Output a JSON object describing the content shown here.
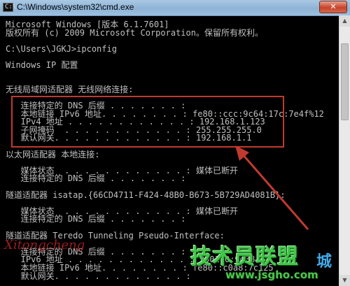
{
  "window": {
    "title": "C:\\Windows\\system32\\cmd.exe",
    "app_icon_glyph": "C:\\",
    "close_glyph": "✕"
  },
  "console_lines": [
    "Microsoft Windows [版本 6.1.7601]",
    "版权所有 (c) 2009 Microsoft Corporation。保留所有权利。",
    "",
    "C:\\Users\\JGKJ>ipconfig",
    "",
    "Windows IP 配置",
    "",
    "",
    "无线局域网适配器 无线网络连接:",
    "",
    "   连接特定的 DNS 后缀 . . . . . . . :",
    "   本地链接 IPv6 地址. . . . . . . . : fe80::ccc:9c64:17c:7e4f%12",
    "   IPv4 地址 . . . . . . . . . . . . : 192.168.1.123",
    "   子网掩码  . . . . . . . . . . . . : 255.255.255.0",
    "   默认网关. . . . . . . . . . . . . : 192.168.1.1",
    "",
    "以太网适配器 本地连接:",
    "",
    "   媒体状态  . . . . . . . . . . . . : 媒体已断开",
    "   连接特定的 DNS 后缀 . . . . . . . :",
    "",
    "隧道适配器 isatap.{66CD4711-F424-48B0-B673-5B729AD4081B}:",
    "",
    "   媒体状态  . . . . . . . . . . . . : 媒体已断开",
    "   连接特定的 DNS 后缀 . . . . . . . :",
    "",
    "隧道适配器 Teredo Tunneling Pseudo-Interface:",
    "",
    "   连接特定的 DNS 后缀 . . . . . . . :",
    "   IPv6 地址 . . . . . . . . . . . . : 2001:0:9d38:6a",
    "   本地链接 IPv6 地址. . . . . . . . : fe80::c0a8:7c125",
    "   默认网关. . . . . . . . . . . . . :"
  ],
  "colors": {
    "console_bg": "#000000",
    "console_text": "#c0c0c0",
    "annotation": "#c03a2e"
  },
  "watermarks": {
    "left": "Xitongcheng",
    "logo": "技术员联盟",
    "url": "www.jsgho.com",
    "corner": "城"
  }
}
